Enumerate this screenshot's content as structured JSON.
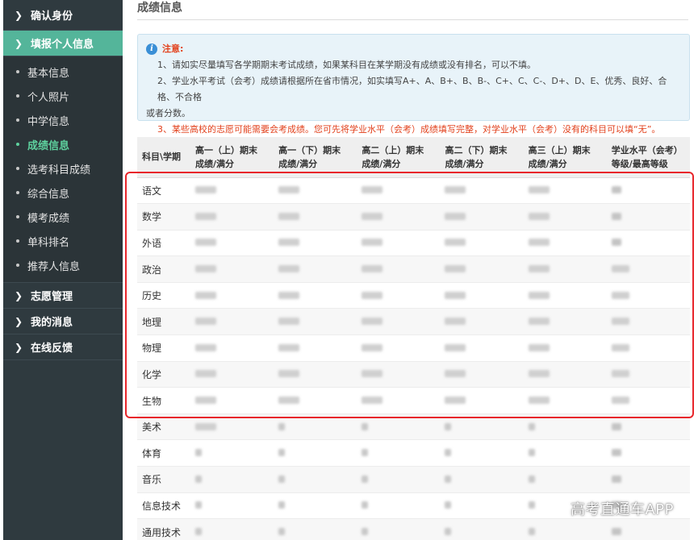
{
  "sidebar": {
    "groups_top": [
      {
        "label": "确认身份"
      },
      {
        "label": "填报个人信息"
      }
    ],
    "sub_items": [
      {
        "label": "基本信息"
      },
      {
        "label": "个人照片"
      },
      {
        "label": "中学信息"
      },
      {
        "label": "成绩信息"
      },
      {
        "label": "选考科目成绩"
      },
      {
        "label": "综合信息"
      },
      {
        "label": "模考成绩"
      },
      {
        "label": "单科排名"
      },
      {
        "label": "推荐人信息"
      }
    ],
    "groups_bottom": [
      {
        "label": "志愿管理"
      },
      {
        "label": "我的消息"
      },
      {
        "label": "在线反馈"
      }
    ],
    "active_group": "填报个人信息",
    "current_item": "成绩信息"
  },
  "main": {
    "section_title": "成绩信息",
    "notice": {
      "title": "注意:",
      "line1": "1、请如实尽量填写各学期期末考试成绩，如果某科目在某学期没有成绩或没有排名，可以不填。",
      "line2a": "2、学业水平考试（会考）成绩请根据所在省市情况，如实填写A+、A、B+、B、B-、C+、C、C-、D+、D、E、优秀、良好、合格、不合格",
      "line2b": "或者分数。",
      "line3": "3、某些高校的志愿可能需要会考成绩。您可先将学业水平（会考）成绩填写完整，对学业水平（会考）没有的科目可以填“无”。"
    },
    "table": {
      "headers": [
        {
          "l1": "科目\\学期",
          "l2": ""
        },
        {
          "l1": "高一（上）期末",
          "l2": "成绩/满分"
        },
        {
          "l1": "高一（下）期末",
          "l2": "成绩/满分"
        },
        {
          "l1": "高二（上）期末",
          "l2": "成绩/满分"
        },
        {
          "l1": "高二（下）期末",
          "l2": "成绩/满分"
        },
        {
          "l1": "高三（上）期末",
          "l2": "成绩/满分"
        },
        {
          "l1": "学业水平（会考）",
          "l2": "等级/最高等级"
        }
      ],
      "subjects": [
        "语文",
        "数学",
        "外语",
        "政治",
        "历史",
        "地理",
        "物理",
        "化学",
        "生物",
        "美术",
        "体育",
        "音乐",
        "信息技术",
        "通用技术"
      ]
    }
  },
  "watermark": "高考直通车APP",
  "colors": {
    "sidebar_bg": "#2f3a3f",
    "active_green": "#54b59a",
    "current_item_green": "#5ed19e",
    "notice_bg": "#e8f3f9",
    "notice_red": "#e2411c",
    "highlight_red": "#e8262b"
  }
}
